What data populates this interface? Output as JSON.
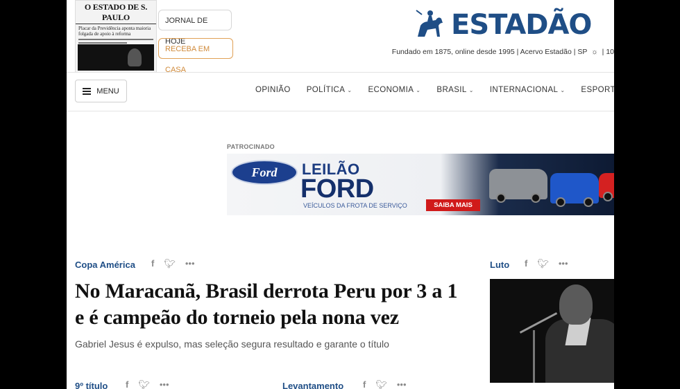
{
  "masthead": {
    "edition_title": "O ESTADO DE S. PAULO",
    "edition_headline": "Placar da Previdência aponta maioria folgada de apoio à reforma",
    "jornal_label": "JORNAL DE HOJE",
    "receba_label": "RECEBA EM CASA",
    "logo_text": "ESTADÃO",
    "tagline": "Fundado em 1875, online desde 1995 | Acervo Estadão | SP",
    "temp": "10"
  },
  "nav": {
    "menu_label": "MENU",
    "items": [
      "OPINIÃO",
      "POLÍTICA",
      "ECONOMIA",
      "BRASIL",
      "INTERNACIONAL",
      "ESPORTES"
    ]
  },
  "ad": {
    "sponsored_label": "PATROCINADO",
    "brand": "Ford",
    "title_top": "LEILÃO",
    "title_main": "FORD",
    "subtitle": "VEÍCULOS DA FROTA DE SERVIÇO",
    "cta": "SAIBA MAIS"
  },
  "main_story": {
    "kicker": "Copa América",
    "headline": "No Maracanã, Brasil derrota Peru por 3 a 1 e é campeão do torneio pela nona vez",
    "summary": "Gabriel Jesus é expulso, mas seleção segura resultado e garante o título"
  },
  "side_story": {
    "kicker": "Luto"
  },
  "bottom": {
    "kicker_left": "9º título",
    "kicker_right": "Levantamento"
  },
  "social": {
    "facebook": "f",
    "twitter": "t",
    "more": "•••"
  }
}
